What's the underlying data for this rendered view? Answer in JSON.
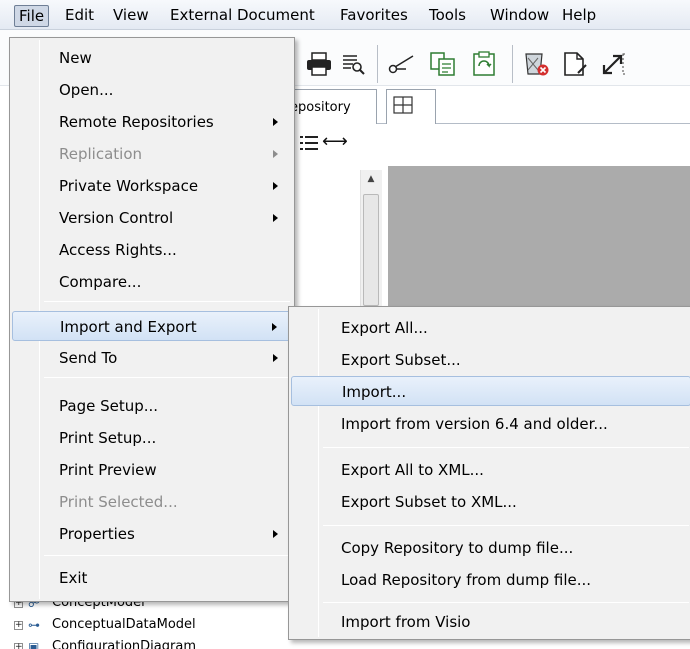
{
  "menubar": {
    "items": [
      "File",
      "Edit",
      "View",
      "External Document",
      "Favorites",
      "Tools",
      "Window",
      "Help"
    ]
  },
  "tabs": {
    "repository_label": "epository"
  },
  "tree": {
    "items": [
      "ConceptModel",
      "ConceptualDataModel",
      "ConfigurationDiagram"
    ]
  },
  "file_menu": {
    "items": [
      {
        "label": "New"
      },
      {
        "label": "Open..."
      },
      {
        "label": "Remote Repositories"
      },
      {
        "label": "Replication"
      },
      {
        "label": "Private Workspace"
      },
      {
        "label": "Version Control"
      },
      {
        "label": "Access Rights..."
      },
      {
        "label": "Compare..."
      },
      {
        "label": "Import and Export"
      },
      {
        "label": "Send To"
      },
      {
        "label": "Page Setup..."
      },
      {
        "label": "Print Setup..."
      },
      {
        "label": "Print Preview"
      },
      {
        "label": "Print Selected..."
      },
      {
        "label": "Properties"
      },
      {
        "label": "Exit"
      }
    ]
  },
  "import_export_menu": {
    "items": [
      {
        "label": "Export All..."
      },
      {
        "label": "Export Subset..."
      },
      {
        "label": "Import..."
      },
      {
        "label": "Import from version 6.4 and older..."
      },
      {
        "label": "Export All to XML..."
      },
      {
        "label": "Export Subset to XML..."
      },
      {
        "label": "Copy Repository to dump file..."
      },
      {
        "label": "Load Repository from dump file..."
      },
      {
        "label": "Import from Visio"
      }
    ]
  },
  "colors": {
    "menu_background": "#f1f1f1",
    "highlight_border": "#a6bfdf",
    "disabled_text": "#8d8d8d",
    "canvas_grey": "#ababab"
  }
}
